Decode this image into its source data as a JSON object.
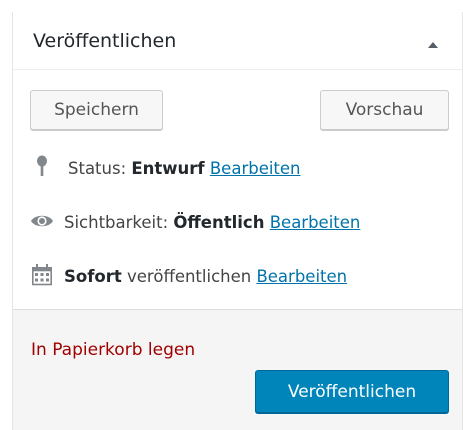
{
  "header": {
    "title": "Veröffentlichen",
    "toggle_icon": "triangle-up-icon"
  },
  "actions": {
    "save_label": "Speichern",
    "preview_label": "Vorschau"
  },
  "status": {
    "icon": "pin-icon",
    "label": "Status:",
    "value": "Entwurf",
    "edit_label": "Bearbeiten"
  },
  "visibility": {
    "icon": "eye-icon",
    "label": "Sichtbarkeit:",
    "value": "Öffentlich",
    "edit_label": "Bearbeiten"
  },
  "schedule": {
    "icon": "calendar-icon",
    "value": "Sofort",
    "label": "veröffentlichen",
    "edit_label": "Bearbeiten"
  },
  "footer": {
    "trash_label": "In Papierkorb legen",
    "publish_label": "Veröffentlichen"
  },
  "colors": {
    "link": "#0073aa",
    "trash": "#a00000",
    "primary": "#0085ba"
  }
}
